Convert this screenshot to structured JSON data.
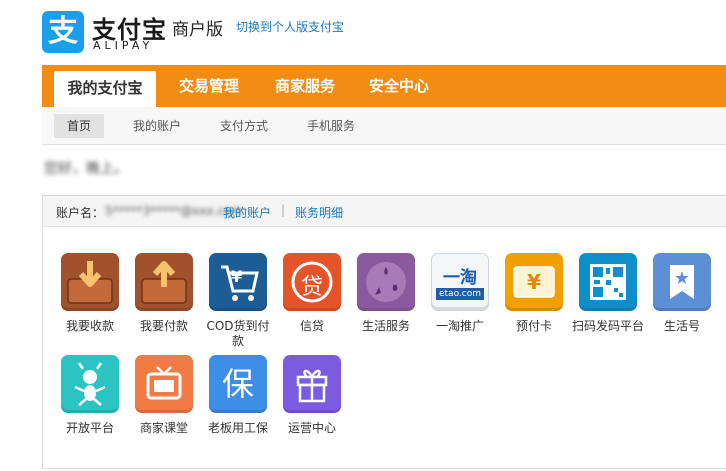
{
  "header": {
    "logo_glyph": "支",
    "logo_cn": "支付宝",
    "logo_en": "ALIPAY",
    "edition": "商户版",
    "switch_link": "切换到个人版支付宝"
  },
  "main_nav": {
    "tabs": [
      {
        "label": "我的支付宝",
        "active": true
      },
      {
        "label": "交易管理",
        "active": false
      },
      {
        "label": "商家服务",
        "active": false
      },
      {
        "label": "安全中心",
        "active": false
      }
    ]
  },
  "sub_nav": {
    "tabs": [
      {
        "label": "首页",
        "active": true
      },
      {
        "label": "我的账户",
        "active": false
      },
      {
        "label": "支付方式",
        "active": false
      },
      {
        "label": "手机服务",
        "active": false
      }
    ]
  },
  "greeting": "您好，晚上。",
  "account": {
    "label": "账户名：",
    "value": "5*****3*****@xxx.com",
    "link_account": "我的账户",
    "separator": "|",
    "link_statement": "账务明细"
  },
  "apps": [
    {
      "label": "我要收款",
      "icon": "receive-money-icon",
      "color": "#a0522d",
      "glyph": ""
    },
    {
      "label": "我要付款",
      "icon": "pay-money-icon",
      "color": "#a0522d",
      "glyph": ""
    },
    {
      "label": "COD货到付款",
      "icon": "cod-cart-icon",
      "color": "#1d5d95",
      "glyph": "¥"
    },
    {
      "label": "信贷",
      "icon": "credit-loan-icon",
      "color": "#e5532b",
      "glyph": "贷"
    },
    {
      "label": "生活服务",
      "icon": "life-service-icon",
      "color": "#8b5a9e",
      "glyph": ""
    },
    {
      "label": "一淘推广",
      "icon": "etao-icon",
      "color": "#f4f6f8",
      "glyph": "一淘",
      "sub": "etao.com"
    },
    {
      "label": "预付卡",
      "icon": "prepaid-card-icon",
      "color": "#f2a000",
      "glyph": "¥"
    },
    {
      "label": "扫码发码平台",
      "icon": "qr-code-icon",
      "color": "#0e8fc9",
      "glyph": ""
    },
    {
      "label": "生活号",
      "icon": "life-account-icon",
      "color": "#5d8fd4",
      "glyph": "★"
    },
    {
      "label": "开放平台",
      "icon": "open-platform-icon",
      "color": "#2cc3c3",
      "glyph": ""
    },
    {
      "label": "商家课堂",
      "icon": "merchant-class-icon",
      "color": "#f07b45",
      "glyph": ""
    },
    {
      "label": "老板用工保",
      "icon": "employer-insurance-icon",
      "color": "#3d8ee6",
      "glyph": "保"
    },
    {
      "label": "运营中心",
      "icon": "operation-center-icon",
      "color": "#7b5be0",
      "glyph": ""
    }
  ]
}
